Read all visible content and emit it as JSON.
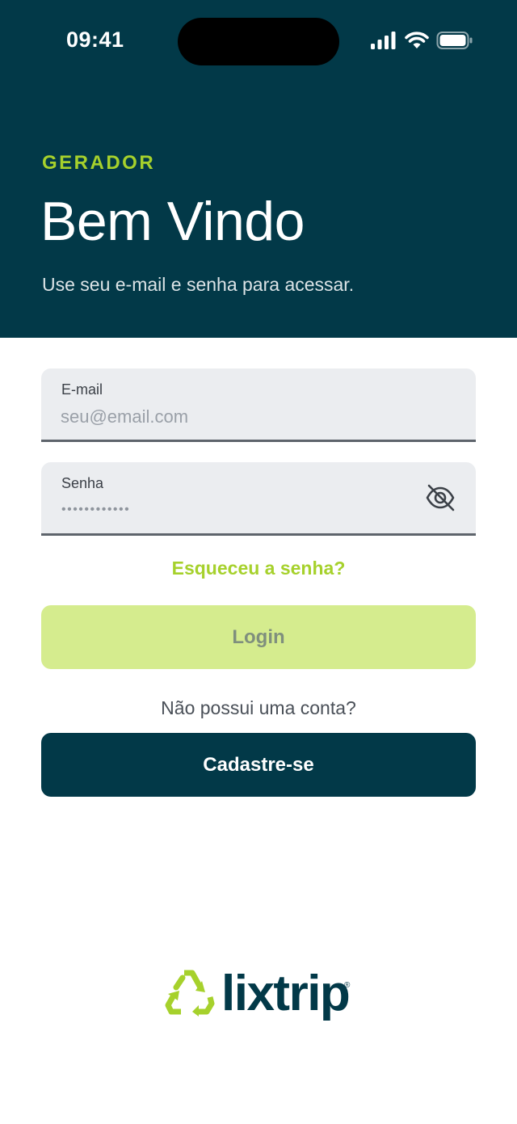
{
  "status_bar": {
    "time": "09:41"
  },
  "header": {
    "role": "GERADOR",
    "title": "Bem Vindo",
    "subtitle": "Use seu e-mail e senha para acessar."
  },
  "form": {
    "email": {
      "label": "E-mail",
      "placeholder": "seu@email.com",
      "value": ""
    },
    "password": {
      "label": "Senha",
      "masked_value": "••••••••••••",
      "toggle_icon": "eye-off-icon"
    },
    "forgot_password_link": "Esqueceu a senha?",
    "login_button": "Login",
    "no_account_text": "Não possui uma conta?",
    "signup_button": "Cadastre-se"
  },
  "brand": {
    "name": "lixtrip",
    "registered_mark": "®"
  },
  "colors": {
    "primary_dark": "#023948",
    "accent_green": "#a6d12c",
    "login_disabled_bg": "#d5ec8e",
    "field_bg": "#ebedf0"
  }
}
